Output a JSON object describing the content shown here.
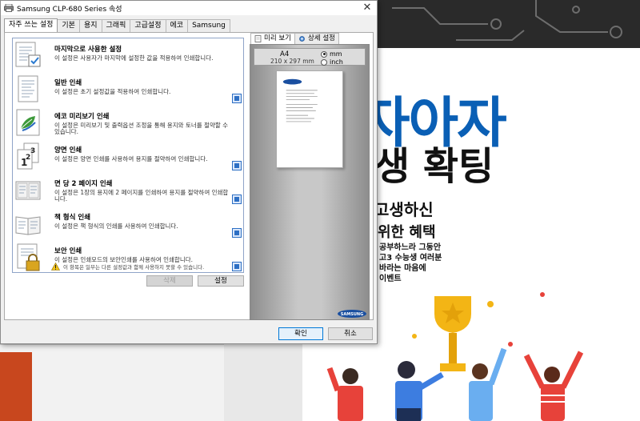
{
  "dialog": {
    "title": "Samsung CLP-680 Series 속성",
    "close_glyph": "✕",
    "tabs": [
      "자주 쓰는 설정",
      "기본",
      "용지",
      "그래픽",
      "고급설정",
      "에코",
      "Samsung"
    ],
    "active_tab": 0
  },
  "favorites": [
    {
      "title": "마지막으로 사용한 설정",
      "desc": "이 설정은 사용자가 마지막에 설정한 값을 적용하여 인쇄합니다.",
      "icon": "last-used-doc-icon"
    },
    {
      "title": "일반 인쇄",
      "desc": "이 설정은 초기 설정값을 적용하여 인쇄합니다.",
      "icon": "normal-print-doc-icon"
    },
    {
      "title": "에코 미리보기 인쇄",
      "desc": "이 설정은 미리보기 및 출력옵션 조정을 통해 용지와 토너를 절약할 수 있습니다.",
      "icon": "eco-leaf-icon"
    },
    {
      "title": "양면 인쇄",
      "desc": "이 설정은 양면 인쇄를 사용하여 용지를 절약하여 인쇄합니다.",
      "icon": "duplex-pages-icon"
    },
    {
      "title": "면 당 2 페이지 인쇄",
      "desc": "이 설정은 1장의 용지에 2 페이지를 인쇄하여 용지를 절약하여 인쇄합니다.",
      "icon": "two-up-pages-icon"
    },
    {
      "title": "책 형식 인쇄",
      "desc": "이 설정은 책 형식의 인쇄를 사용하여 인쇄합니다.",
      "icon": "booklet-icon"
    },
    {
      "title": "보안 인쇄",
      "desc": "이 설정은 인쇄모드의 보안인쇄를 사용하여 인쇄합니다.",
      "icon": "lock-doc-icon"
    }
  ],
  "warning_text": "이 항목은 일부는 다른 설정값과 함께 사용하지 못할 수 있습니다.",
  "buttons": {
    "delete": "삭제",
    "set": "설정",
    "ok": "확인",
    "cancel": "취소"
  },
  "preview": {
    "tabs": [
      "미리 보기",
      "상세 설정"
    ],
    "paper_size": "A4",
    "paper_dims": "210 x 297 mm",
    "units": [
      {
        "label": "mm",
        "selected": true
      },
      {
        "label": "inch",
        "selected": false
      }
    ],
    "brand": "SAMSUNG"
  },
  "background": {
    "poster_lines": [
      "자아자",
      "생 확팅",
      "고생하신",
      "위한 혜택",
      "공부하느라 그동안",
      "고3 수능생 여러분",
      "바라는 마음에",
      "이벤트"
    ]
  }
}
